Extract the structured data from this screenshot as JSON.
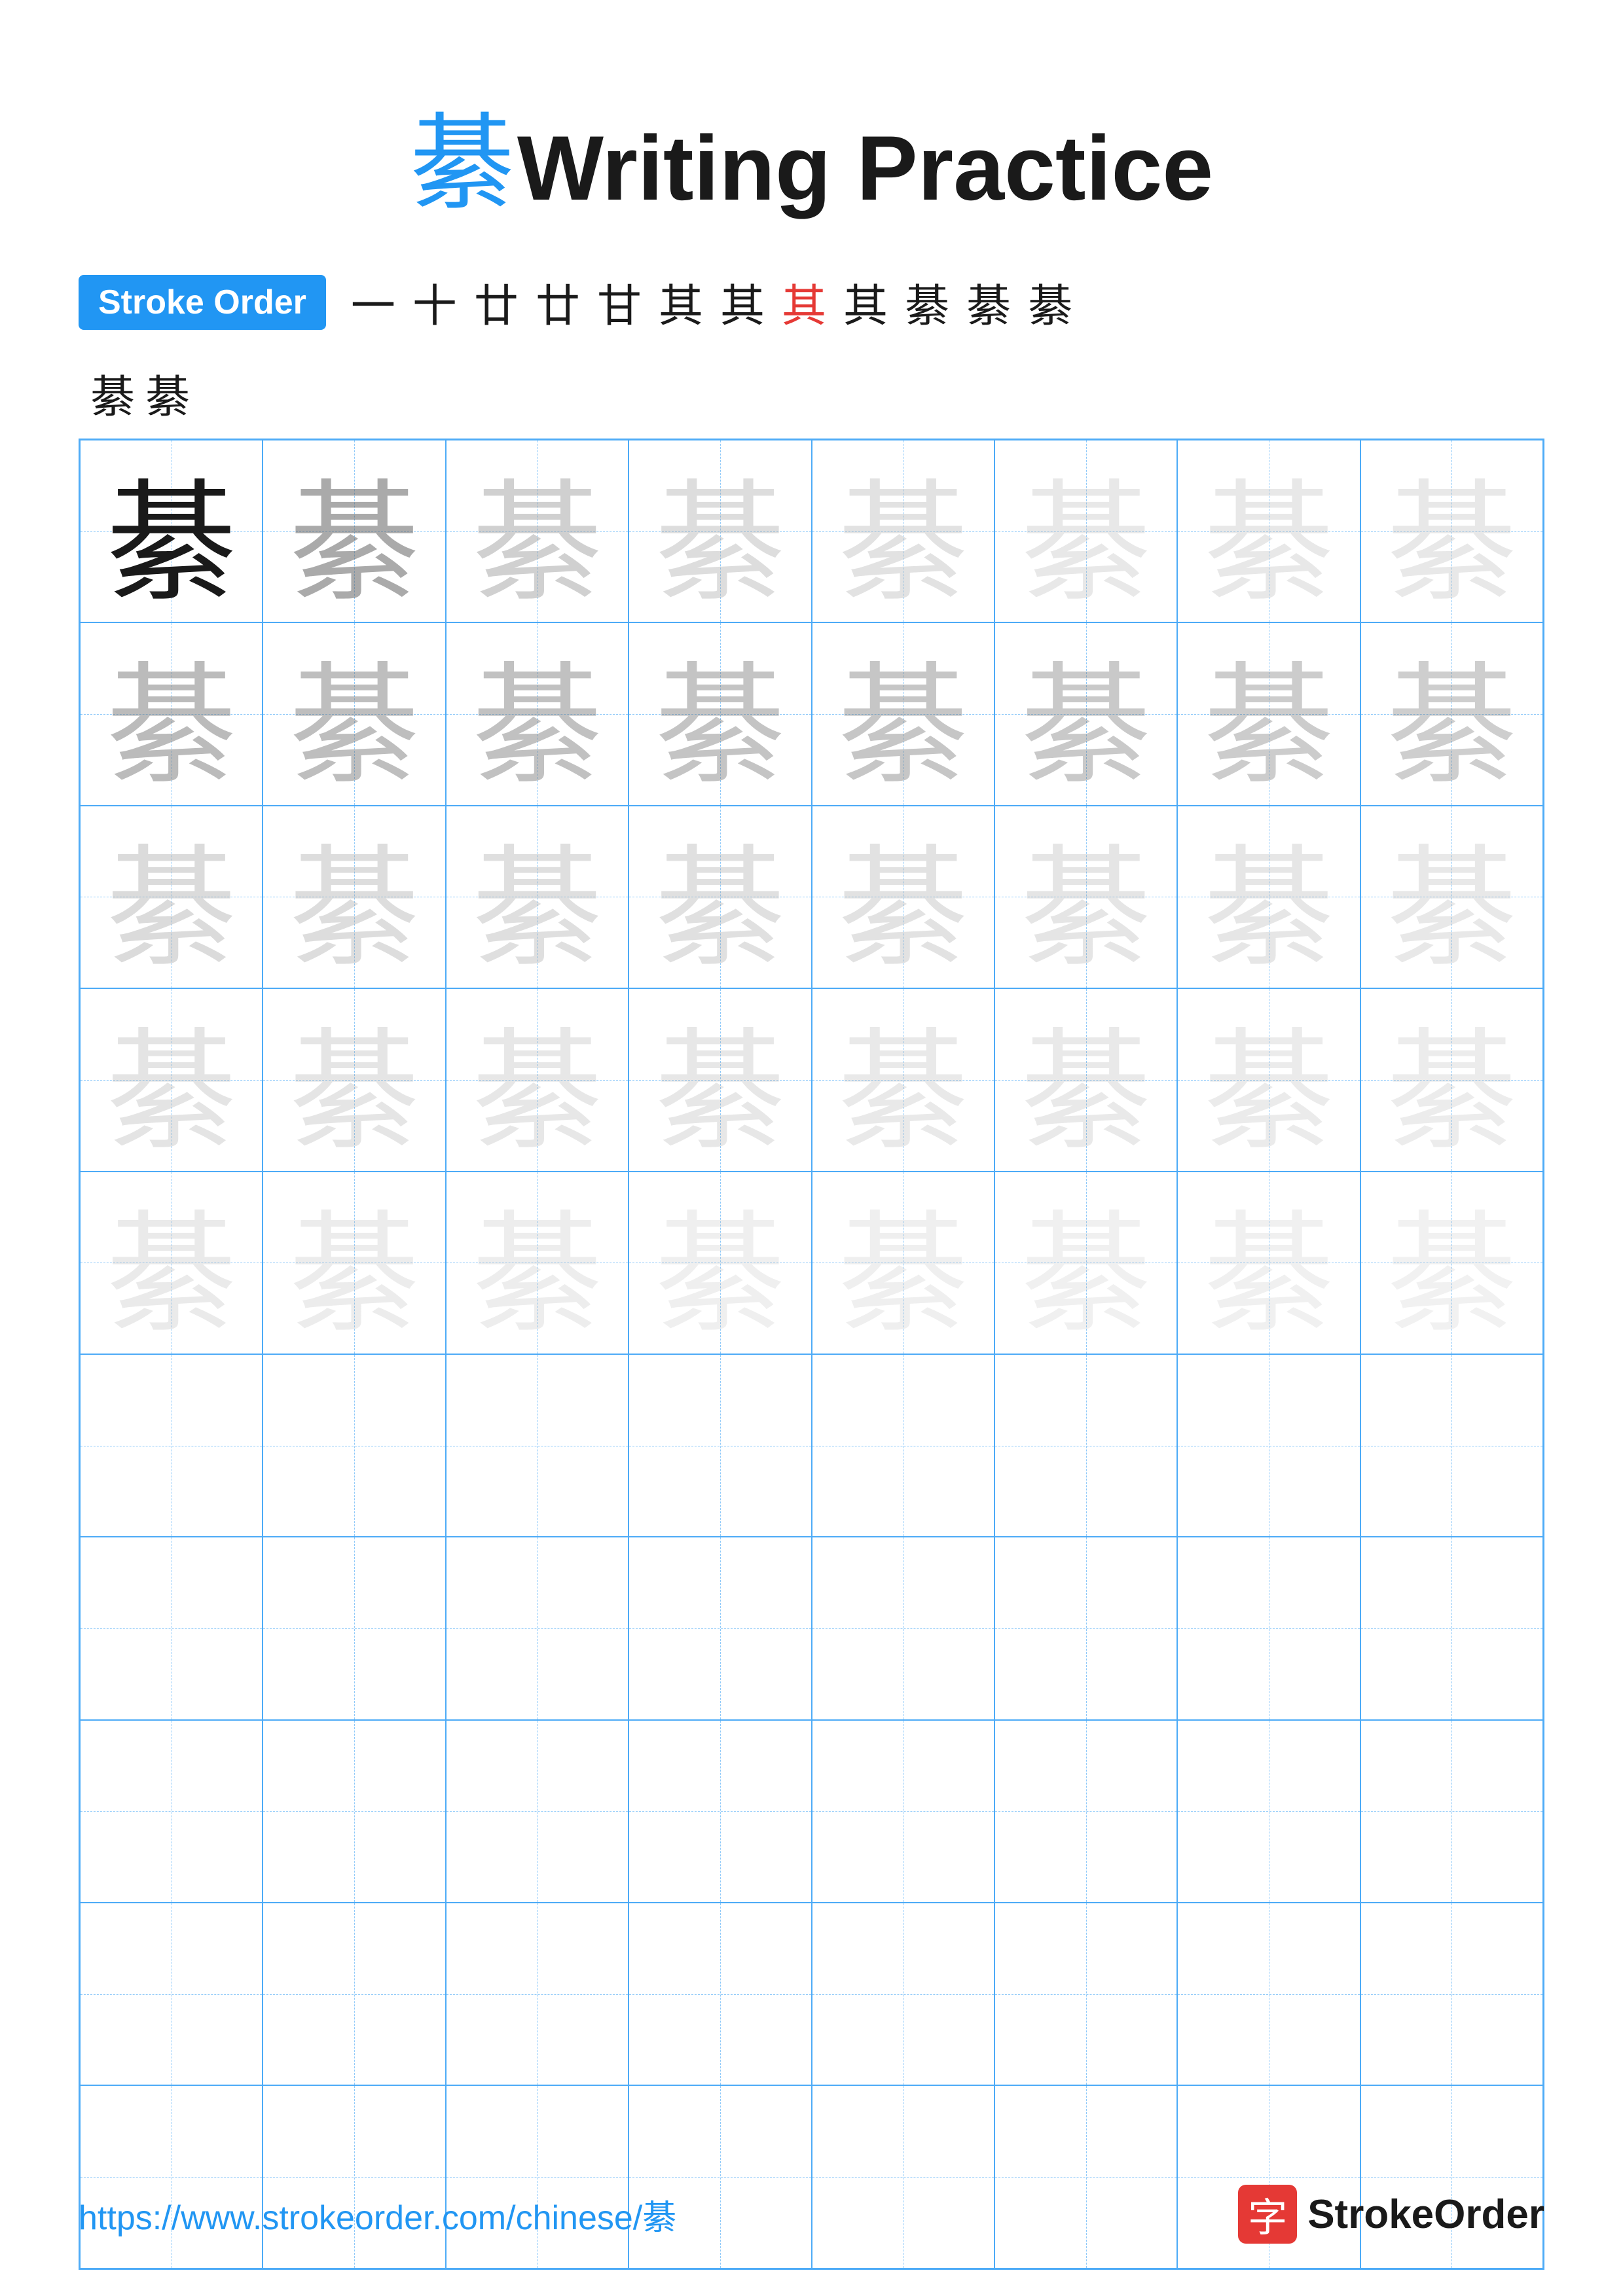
{
  "title": {
    "char": "綦",
    "text": "Writing Practice"
  },
  "stroke_order": {
    "badge_label": "Stroke Order",
    "chars": [
      "一",
      "十",
      "廿",
      "廿",
      "甘",
      "其",
      "其",
      "其",
      "其",
      "綦",
      "綦",
      "綦",
      "綦",
      "綦"
    ],
    "red_index": 7
  },
  "practice_char": "綦",
  "grid": {
    "rows": 10,
    "cols": 8,
    "filled_rows": 5,
    "empty_rows": 5
  },
  "footer": {
    "url": "https://www.strokeorder.com/chinese/綦",
    "logo_char": "字",
    "logo_text": "StrokeOrder"
  }
}
